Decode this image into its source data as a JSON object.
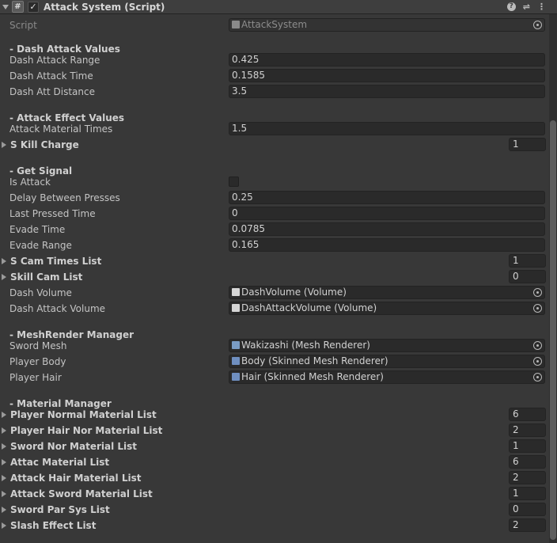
{
  "header": {
    "title": "Attack System (Script)",
    "enabled": true
  },
  "script": {
    "label": "Script",
    "value": "AttackSystem",
    "icon": "script-file-icon"
  },
  "sections": [
    {
      "title": "- Dash Attack Values",
      "rows": [
        {
          "kind": "float",
          "label": "Dash Attack Range",
          "value": "0.425"
        },
        {
          "kind": "float",
          "label": "Dash Attack Time",
          "value": "0.1585"
        },
        {
          "kind": "float",
          "label": "Dash Att Distance",
          "value": "3.5"
        }
      ]
    },
    {
      "title": "- Attack Effect Values",
      "rows": [
        {
          "kind": "float",
          "label": "Attack Material Times",
          "value": "1.5"
        },
        {
          "kind": "list",
          "label": "S Kill Charge",
          "value": "1"
        }
      ]
    },
    {
      "title": "- Get Signal",
      "rows": [
        {
          "kind": "bool",
          "label": "Is Attack",
          "value": false
        },
        {
          "kind": "float",
          "label": "Delay Between Presses",
          "value": "0.25"
        },
        {
          "kind": "float",
          "label": "Last Pressed Time",
          "value": "0"
        },
        {
          "kind": "float",
          "label": "Evade Time",
          "value": "0.0785"
        },
        {
          "kind": "float",
          "label": "Evade Range",
          "value": "0.165"
        },
        {
          "kind": "list",
          "label": "S Cam Times List",
          "value": "1"
        },
        {
          "kind": "list",
          "label": "Skill Cam List",
          "value": "0"
        },
        {
          "kind": "object",
          "label": "Dash Volume",
          "value": "DashVolume (Volume)",
          "icon": "cube-icon"
        },
        {
          "kind": "object",
          "label": "Dash Attack Volume",
          "value": "DashAttackVolume (Volume)",
          "icon": "cube-icon"
        }
      ]
    },
    {
      "title": "- MeshRender Manager",
      "rows": [
        {
          "kind": "object",
          "label": "Sword Mesh",
          "value": "Wakizashi (Mesh Renderer)",
          "icon": "mesh-renderer-icon"
        },
        {
          "kind": "object",
          "label": "Player Body",
          "value": "Body (Skinned Mesh Renderer)",
          "icon": "skinned-mesh-icon"
        },
        {
          "kind": "object",
          "label": "Player Hair",
          "value": "Hair (Skinned Mesh Renderer)",
          "icon": "skinned-mesh-icon"
        }
      ]
    },
    {
      "title": "- Material Manager",
      "rows": [
        {
          "kind": "list",
          "label": "Player Normal Material List",
          "value": "6"
        },
        {
          "kind": "list",
          "label": "Player Hair Nor Material List",
          "value": "2"
        },
        {
          "kind": "list",
          "label": "Sword Nor Material List",
          "value": "1"
        },
        {
          "kind": "list",
          "label": "Attac Material List",
          "value": "6"
        },
        {
          "kind": "list",
          "label": "Attack Hair Material List",
          "value": "2"
        },
        {
          "kind": "list",
          "label": "Attack Sword Material List",
          "value": "1"
        },
        {
          "kind": "list",
          "label": "Sword Par Sys List",
          "value": "0"
        },
        {
          "kind": "list",
          "label": "Slash Effect List",
          "value": "2"
        }
      ]
    }
  ]
}
